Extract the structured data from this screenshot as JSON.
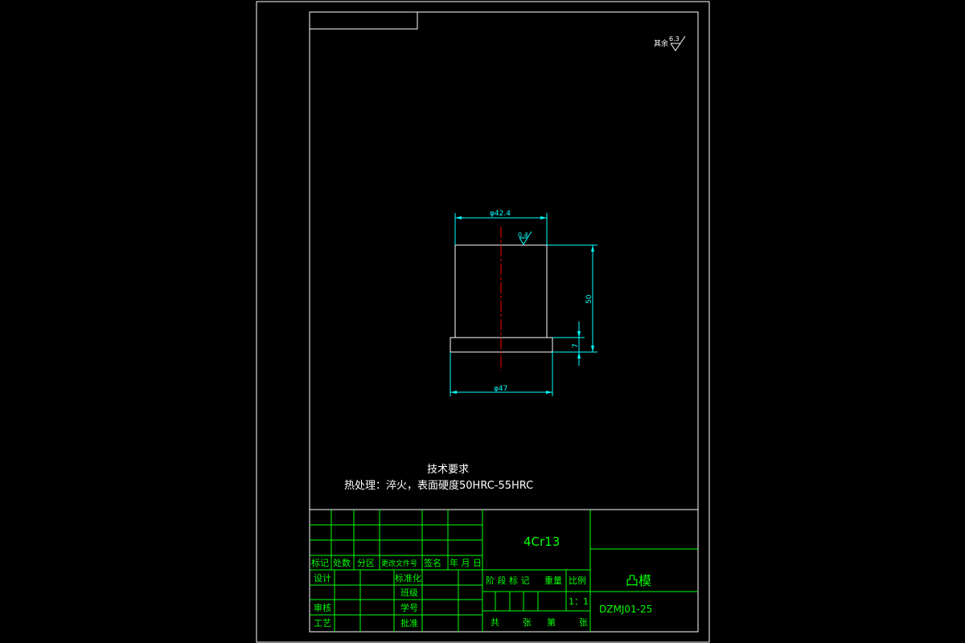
{
  "colors": {
    "background": "#000000",
    "outline": "#ffffff",
    "table": "#00ff00",
    "dimension": "#00ffff",
    "centerline": "#ff0000"
  },
  "drawing": {
    "roughness_corner": "其余",
    "roughness_corner_value": "6.3",
    "roughness_part_value": "0.4",
    "dim_top_diameter": "φ42.4",
    "dim_bottom_diameter": "φ47",
    "dim_height": "50",
    "dim_flange": "7"
  },
  "notes": {
    "heading": "技术要求",
    "line1": "热处理：淬火，表面硬度50HRC-55HRC"
  },
  "title_block": {
    "material": "4Cr13",
    "part_name": "凸模",
    "drawing_no": "DZMJ01-25",
    "scale": "1：1",
    "rev_headers": [
      "标记",
      "处数",
      "分区",
      "更改文件号",
      "签名",
      "年 月 日"
    ],
    "design": "设计",
    "standard": "标准化",
    "audit": "审核",
    "craft": "工艺",
    "check": "批准",
    "class": "班级",
    "student_no": "学号",
    "stage_mark": "阶 段 标 记",
    "weight": "重量",
    "ratio": "比例",
    "total": "共",
    "sheets": "张",
    "page": "第",
    "sheet2": "张"
  }
}
